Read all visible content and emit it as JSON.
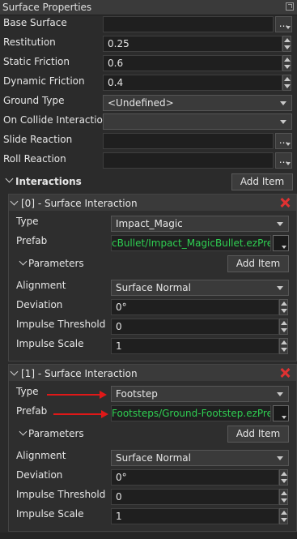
{
  "panel": {
    "title": "Surface Properties"
  },
  "properties": {
    "base_surface": {
      "label": "Base Surface",
      "value": ""
    },
    "restitution": {
      "label": "Restitution",
      "value": "0.25"
    },
    "static_friction": {
      "label": "Static Friction",
      "value": "0.6"
    },
    "dynamic_friction": {
      "label": "Dynamic Friction",
      "value": "0.4"
    },
    "ground_type": {
      "label": "Ground Type",
      "value": "<Undefined>"
    },
    "on_collide": {
      "label": "On Collide Interaction",
      "value": ""
    },
    "slide_reaction": {
      "label": "Slide Reaction",
      "value": ""
    },
    "roll_reaction": {
      "label": "Roll Reaction",
      "value": ""
    }
  },
  "browse_label": "...",
  "interactions": {
    "label": "Interactions",
    "add_item": "Add Item",
    "items": [
      {
        "header": "[0] - Surface Interaction",
        "type_label": "Type",
        "type_value": "Impact_Magic",
        "prefab_label": "Prefab",
        "prefab_value": "cBullet/Impact_MagicBullet.ezPrefab",
        "parameters_label": "Parameters",
        "add_item": "Add Item",
        "alignment_label": "Alignment",
        "alignment_value": "Surface Normal",
        "deviation_label": "Deviation",
        "deviation_value": "0°",
        "impulse_threshold_label": "Impulse Threshold",
        "impulse_threshold_value": "0",
        "impulse_scale_label": "Impulse Scale",
        "impulse_scale_value": "1"
      },
      {
        "header": "[1] - Surface Interaction",
        "type_label": "Type",
        "type_value": "Footstep",
        "prefab_label": "Prefab",
        "prefab_value": "Footsteps/Ground-Footstep.ezPrefab",
        "parameters_label": "Parameters",
        "add_item": "Add Item",
        "alignment_label": "Alignment",
        "alignment_value": "Surface Normal",
        "deviation_label": "Deviation",
        "deviation_value": "0°",
        "impulse_threshold_label": "Impulse Threshold",
        "impulse_threshold_value": "0",
        "impulse_scale_label": "Impulse Scale",
        "impulse_scale_value": "1"
      }
    ]
  },
  "colors": {
    "accent_green": "#2fcf52",
    "annotation_red": "#e01818",
    "delete_red": "#e03232"
  }
}
